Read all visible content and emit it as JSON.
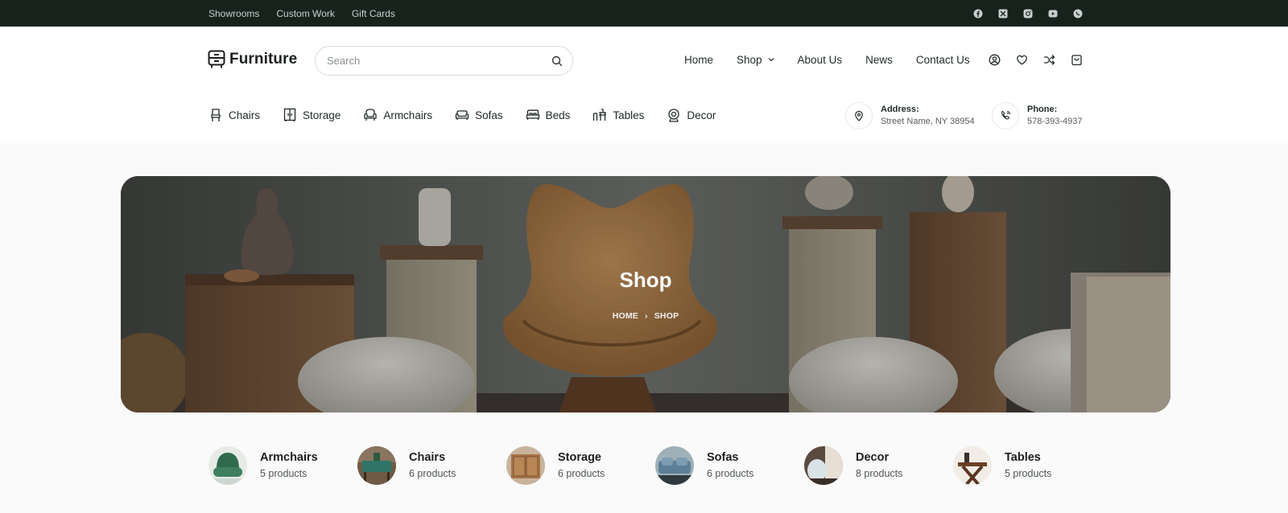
{
  "topbar": {
    "links": [
      "Showrooms",
      "Custom Work",
      "Gift Cards"
    ],
    "social_icons": [
      "facebook-icon",
      "x-icon",
      "instagram-icon",
      "youtube-icon",
      "whatsapp-icon"
    ]
  },
  "header": {
    "logo_text": "Furniture",
    "search_placeholder": "Search",
    "nav": {
      "home": "Home",
      "shop": "Shop",
      "about": "About Us",
      "news": "News",
      "contact": "Contact Us"
    },
    "user_icons": [
      "account-icon",
      "wishlist-heart-icon",
      "compare-shuffle-icon",
      "cart-bag-icon"
    ]
  },
  "categories_nav": {
    "chairs": "Chairs",
    "storage": "Storage",
    "armchairs": "Armchairs",
    "sofas": "Sofas",
    "beds": "Beds",
    "tables": "Tables",
    "decor": "Decor"
  },
  "contact": {
    "address_label": "Address:",
    "address_value": "Street Name, NY 38954",
    "phone_label": "Phone:",
    "phone_value": "578-393-4937"
  },
  "hero": {
    "title": "Shop",
    "breadcrumb_home": "HOME",
    "breadcrumb_separator": "›",
    "breadcrumb_current": "SHOP"
  },
  "category_cards": [
    {
      "name": "Armchairs",
      "count": "5 products"
    },
    {
      "name": "Chairs",
      "count": "6 products"
    },
    {
      "name": "Storage",
      "count": "6 products"
    },
    {
      "name": "Sofas",
      "count": "6 products"
    },
    {
      "name": "Decor",
      "count": "8 products"
    },
    {
      "name": "Tables",
      "count": "5 products"
    }
  ],
  "colors": {
    "topbar_bg": "#17221d",
    "text_dark": "#1f2a25",
    "chair_accent": "#a0703c"
  }
}
